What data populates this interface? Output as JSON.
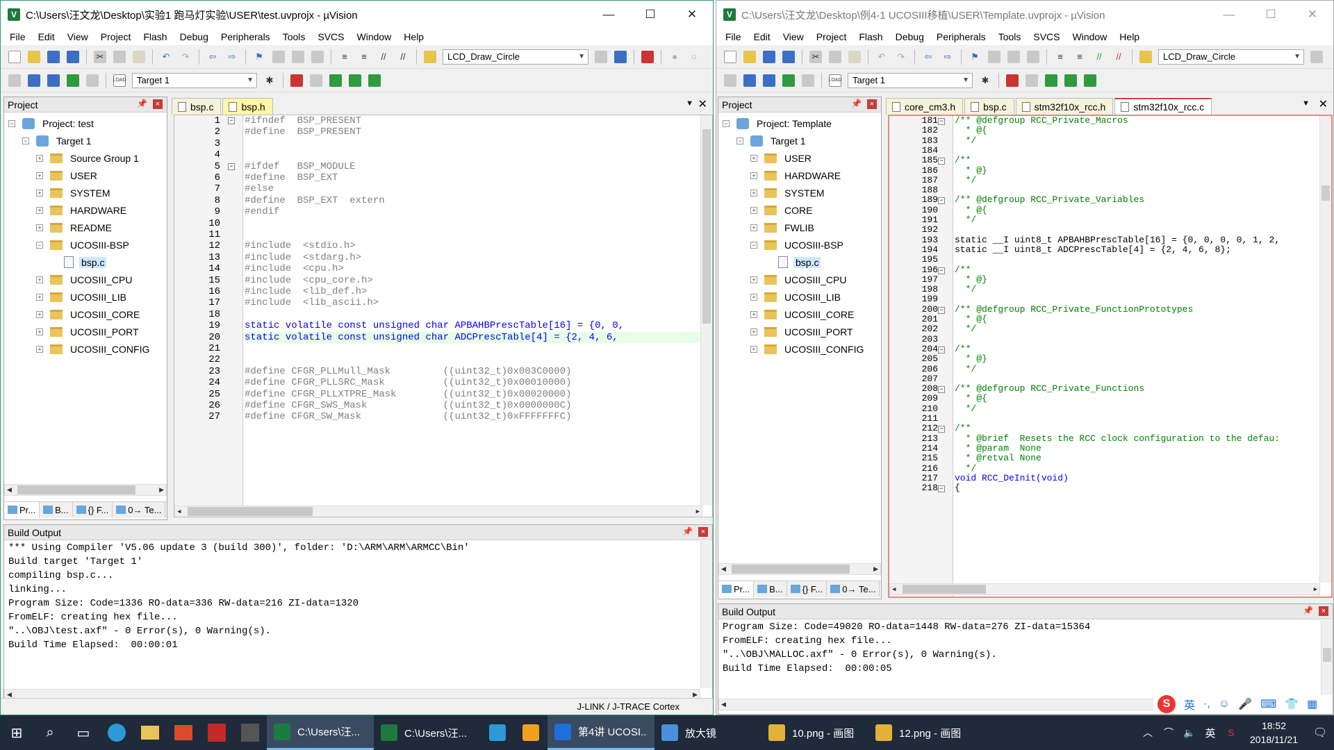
{
  "left": {
    "title": "C:\\Users\\汪文龙\\Desktop\\实验1 跑马灯实验\\USER\\test.uvprojx - µVision",
    "menu": [
      "File",
      "Edit",
      "View",
      "Project",
      "Flash",
      "Debug",
      "Peripherals",
      "Tools",
      "SVCS",
      "Window",
      "Help"
    ],
    "toolbar_combo": "LCD_Draw_Circle",
    "target_combo": "Target 1",
    "project_header": "Project",
    "tree": [
      {
        "label": "Project: test",
        "level": 0,
        "exp": "−",
        "icon": "project"
      },
      {
        "label": "Target 1",
        "level": 1,
        "exp": "−",
        "icon": "target"
      },
      {
        "label": "Source Group 1",
        "level": 2,
        "exp": "+",
        "icon": "folder"
      },
      {
        "label": "USER",
        "level": 2,
        "exp": "+",
        "icon": "folder"
      },
      {
        "label": "SYSTEM",
        "level": 2,
        "exp": "+",
        "icon": "folder"
      },
      {
        "label": "HARDWARE",
        "level": 2,
        "exp": "+",
        "icon": "folder"
      },
      {
        "label": "README",
        "level": 2,
        "exp": "+",
        "icon": "folder"
      },
      {
        "label": "UCOSIII-BSP",
        "level": 2,
        "exp": "−",
        "icon": "folder"
      },
      {
        "label": "bsp.c",
        "level": 3,
        "exp": "",
        "icon": "file"
      },
      {
        "label": "UCOSIII_CPU",
        "level": 2,
        "exp": "+",
        "icon": "folder"
      },
      {
        "label": "UCOSIII_LIB",
        "level": 2,
        "exp": "+",
        "icon": "folder"
      },
      {
        "label": "UCOSIII_CORE",
        "level": 2,
        "exp": "+",
        "icon": "folder"
      },
      {
        "label": "UCOSIII_PORT",
        "level": 2,
        "exp": "+",
        "icon": "folder"
      },
      {
        "label": "UCOSIII_CONFIG",
        "level": 2,
        "exp": "+",
        "icon": "folder"
      }
    ],
    "panel_tabs": [
      "Pr...",
      "B...",
      "{} F...",
      "0→ Te..."
    ],
    "editor_tabs": [
      "bsp.c",
      "bsp.h"
    ],
    "active_tab": "bsp.h",
    "code": [
      {
        "n": "1",
        "f": "−",
        "t": "#ifndef  BSP_PRESENT",
        "c": "pp"
      },
      {
        "n": "2",
        "f": "",
        "t": "#define  BSP_PRESENT",
        "c": "pp"
      },
      {
        "n": "3",
        "f": "",
        "t": "",
        "c": ""
      },
      {
        "n": "4",
        "f": "",
        "t": "",
        "c": ""
      },
      {
        "n": "5",
        "f": "−",
        "t": "#ifdef   BSP_MODULE",
        "c": "pp"
      },
      {
        "n": "6",
        "f": "",
        "t": "#define  BSP_EXT",
        "c": "pp"
      },
      {
        "n": "7",
        "f": "",
        "t": "#else",
        "c": "pp"
      },
      {
        "n": "8",
        "f": "",
        "t": "#define  BSP_EXT  extern",
        "c": "pp"
      },
      {
        "n": "9",
        "f": "",
        "t": "#endif",
        "c": "pp"
      },
      {
        "n": "10",
        "f": "",
        "t": "",
        "c": ""
      },
      {
        "n": "11",
        "f": "",
        "t": "",
        "c": ""
      },
      {
        "n": "12",
        "f": "",
        "t": "#include  <stdio.h>",
        "c": "pp"
      },
      {
        "n": "13",
        "f": "",
        "t": "#include  <stdarg.h>",
        "c": "pp"
      },
      {
        "n": "14",
        "f": "",
        "t": "#include  <cpu.h>",
        "c": "pp"
      },
      {
        "n": "15",
        "f": "",
        "t": "#include  <cpu_core.h>",
        "c": "pp"
      },
      {
        "n": "16",
        "f": "",
        "t": "#include  <lib_def.h>",
        "c": "pp"
      },
      {
        "n": "17",
        "f": "",
        "t": "#include  <lib_ascii.h>",
        "c": "pp"
      },
      {
        "n": "18",
        "f": "",
        "t": "",
        "c": ""
      },
      {
        "n": "19",
        "f": "",
        "t": "static volatile const unsigned char APBAHBPrescTable[16] = {0, 0,",
        "c": "kw"
      },
      {
        "n": "20",
        "f": "",
        "t": "static volatile const unsigned char ADCPrescTable[4] = {2, 4, 6,",
        "c": "kw hl"
      },
      {
        "n": "21",
        "f": "",
        "t": "",
        "c": ""
      },
      {
        "n": "22",
        "f": "",
        "t": "",
        "c": ""
      },
      {
        "n": "23",
        "f": "",
        "t": "#define CFGR_PLLMull_Mask         ((uint32_t)0x003C0000)",
        "c": "pp"
      },
      {
        "n": "24",
        "f": "",
        "t": "#define CFGR_PLLSRC_Mask          ((uint32_t)0x00010000)",
        "c": "pp"
      },
      {
        "n": "25",
        "f": "",
        "t": "#define CFGR_PLLXTPRE_Mask        ((uint32_t)0x00020000)",
        "c": "pp"
      },
      {
        "n": "26",
        "f": "",
        "t": "#define CFGR_SWS_Mask             ((uint32_t)0x0000000C)",
        "c": "pp"
      },
      {
        "n": "27",
        "f": "",
        "t": "#define CFGR_SW_Mask              ((uint32_t)0xFFFFFFFC)",
        "c": "pp"
      }
    ],
    "build_header": "Build Output",
    "build": [
      "*** Using Compiler 'V5.06 update 3 (build 300)', folder: 'D:\\ARM\\ARM\\ARMCC\\Bin'",
      "Build target 'Target 1'",
      "compiling bsp.c...",
      "linking...",
      "Program Size: Code=1336 RO-data=336 RW-data=216 ZI-data=1320",
      "FromELF: creating hex file...",
      "\"..\\OBJ\\test.axf\" - 0 Error(s), 0 Warning(s).",
      "Build Time Elapsed:  00:00:01"
    ],
    "status": "J-LINK / J-TRACE Cortex"
  },
  "right": {
    "title": "C:\\Users\\汪文龙\\Desktop\\例4-1 UCOSIII移植\\USER\\Template.uvprojx - µVision",
    "menu": [
      "File",
      "Edit",
      "View",
      "Project",
      "Flash",
      "Debug",
      "Peripherals",
      "Tools",
      "SVCS",
      "Window",
      "Help"
    ],
    "toolbar_combo": "LCD_Draw_Circle",
    "target_combo": "Target 1",
    "project_header": "Project",
    "tree": [
      {
        "label": "Project: Template",
        "level": 0,
        "exp": "−",
        "icon": "project"
      },
      {
        "label": "Target 1",
        "level": 1,
        "exp": "−",
        "icon": "target"
      },
      {
        "label": "USER",
        "level": 2,
        "exp": "+",
        "icon": "folder"
      },
      {
        "label": "HARDWARE",
        "level": 2,
        "exp": "+",
        "icon": "folder"
      },
      {
        "label": "SYSTEM",
        "level": 2,
        "exp": "+",
        "icon": "folder"
      },
      {
        "label": "CORE",
        "level": 2,
        "exp": "+",
        "icon": "folder"
      },
      {
        "label": "FWLIB",
        "level": 2,
        "exp": "+",
        "icon": "folder"
      },
      {
        "label": "UCOSIII-BSP",
        "level": 2,
        "exp": "−",
        "icon": "folder"
      },
      {
        "label": "bsp.c",
        "level": 3,
        "exp": "",
        "icon": "file"
      },
      {
        "label": "UCOSIII_CPU",
        "level": 2,
        "exp": "+",
        "icon": "folder"
      },
      {
        "label": "UCOSIII_LIB",
        "level": 2,
        "exp": "+",
        "icon": "folder"
      },
      {
        "label": "UCOSIII_CORE",
        "level": 2,
        "exp": "+",
        "icon": "folder"
      },
      {
        "label": "UCOSIII_PORT",
        "level": 2,
        "exp": "+",
        "icon": "folder"
      },
      {
        "label": "UCOSIII_CONFIG",
        "level": 2,
        "exp": "+",
        "icon": "folder"
      }
    ],
    "panel_tabs": [
      "Pr...",
      "B...",
      "{} F...",
      "0→ Te..."
    ],
    "editor_tabs": [
      "core_cm3.h",
      "bsp.c",
      "stm32f10x_rcc.h",
      "stm32f10x_rcc.c"
    ],
    "active_tab": "stm32f10x_rcc.c",
    "code": [
      {
        "n": "181",
        "f": "−",
        "t": "/** @defgroup RCC_Private_Macros",
        "c": "cm"
      },
      {
        "n": "182",
        "f": "",
        "t": "  * @{",
        "c": "cm"
      },
      {
        "n": "183",
        "f": "",
        "t": "  */",
        "c": "cm"
      },
      {
        "n": "184",
        "f": "",
        "t": "",
        "c": ""
      },
      {
        "n": "185",
        "f": "−",
        "t": "/**",
        "c": "cm"
      },
      {
        "n": "186",
        "f": "",
        "t": "  * @}",
        "c": "cm"
      },
      {
        "n": "187",
        "f": "",
        "t": "  */",
        "c": "cm"
      },
      {
        "n": "188",
        "f": "",
        "t": "",
        "c": ""
      },
      {
        "n": "189",
        "f": "−",
        "t": "/** @defgroup RCC_Private_Variables",
        "c": "cm"
      },
      {
        "n": "190",
        "f": "",
        "t": "  * @{",
        "c": "cm"
      },
      {
        "n": "191",
        "f": "",
        "t": "  */",
        "c": "cm"
      },
      {
        "n": "192",
        "f": "",
        "t": "",
        "c": ""
      },
      {
        "n": "193",
        "f": "",
        "t": "static __I uint8_t APBAHBPrescTable[16] = {0, 0, 0, 0, 1, 2,",
        "c": "mixed"
      },
      {
        "n": "194",
        "f": "",
        "t": "static __I uint8_t ADCPrescTable[4] = {2, 4, 6, 8};",
        "c": "mixed"
      },
      {
        "n": "195",
        "f": "",
        "t": "",
        "c": ""
      },
      {
        "n": "196",
        "f": "−",
        "t": "/**",
        "c": "cm"
      },
      {
        "n": "197",
        "f": "",
        "t": "  * @}",
        "c": "cm"
      },
      {
        "n": "198",
        "f": "",
        "t": "  */",
        "c": "cm"
      },
      {
        "n": "199",
        "f": "",
        "t": "",
        "c": ""
      },
      {
        "n": "200",
        "f": "−",
        "t": "/** @defgroup RCC_Private_FunctionPrototypes",
        "c": "cm"
      },
      {
        "n": "201",
        "f": "",
        "t": "  * @{",
        "c": "cm"
      },
      {
        "n": "202",
        "f": "",
        "t": "  */",
        "c": "cm"
      },
      {
        "n": "203",
        "f": "",
        "t": "",
        "c": ""
      },
      {
        "n": "204",
        "f": "−",
        "t": "/**",
        "c": "cm"
      },
      {
        "n": "205",
        "f": "",
        "t": "  * @}",
        "c": "cm"
      },
      {
        "n": "206",
        "f": "",
        "t": "  */",
        "c": "cm"
      },
      {
        "n": "207",
        "f": "",
        "t": "",
        "c": ""
      },
      {
        "n": "208",
        "f": "−",
        "t": "/** @defgroup RCC_Private_Functions",
        "c": "cm"
      },
      {
        "n": "209",
        "f": "",
        "t": "  * @{",
        "c": "cm"
      },
      {
        "n": "210",
        "f": "",
        "t": "  */",
        "c": "cm"
      },
      {
        "n": "211",
        "f": "",
        "t": "",
        "c": ""
      },
      {
        "n": "212",
        "f": "−",
        "t": "/**",
        "c": "cm"
      },
      {
        "n": "213",
        "f": "",
        "t": "  * @brief  Resets the RCC clock configuration to the defau:",
        "c": "cm"
      },
      {
        "n": "214",
        "f": "",
        "t": "  * @param  None",
        "c": "cm"
      },
      {
        "n": "215",
        "f": "",
        "t": "  * @retval None",
        "c": "cm"
      },
      {
        "n": "216",
        "f": "",
        "t": "  */",
        "c": "cm"
      },
      {
        "n": "217",
        "f": "",
        "t": "void RCC_DeInit(void)",
        "c": "kw"
      },
      {
        "n": "218",
        "f": "−",
        "t": "{",
        "c": ""
      }
    ],
    "build_header": "Build Output",
    "build": [
      "Program Size: Code=49020 RO-data=1448 RW-data=276 ZI-data=15364",
      "FromELF: creating hex file...",
      "\"..\\OBJ\\MALLOC.axf\" - 0 Error(s), 0 Warning(s).",
      "Build Time Elapsed:  00:00:05"
    ]
  },
  "taskbar": {
    "apps": [
      {
        "label": "C:\\Users\\汪...",
        "active": true,
        "color": "#1d7a3e"
      },
      {
        "label": "C:\\Users\\汪...",
        "active": false,
        "color": "#1d7a3e"
      },
      {
        "label": "",
        "active": false,
        "color": "#2b9ad6"
      },
      {
        "label": "",
        "active": false,
        "color": "#f0a11c"
      },
      {
        "label": "第4讲 UCOSI...",
        "active": true,
        "color": "#1e6fd9"
      },
      {
        "label": "放大镜",
        "active": false,
        "color": "#4a90d9"
      },
      {
        "label": "10.png - 画图",
        "active": false,
        "color": "#e2b13c"
      },
      {
        "label": "12.png - 画图",
        "active": false,
        "color": "#e2b13c"
      }
    ],
    "tray_lang": "英",
    "time": "18:52",
    "date": "2018/11/21"
  },
  "ime": {
    "lang": "英"
  }
}
